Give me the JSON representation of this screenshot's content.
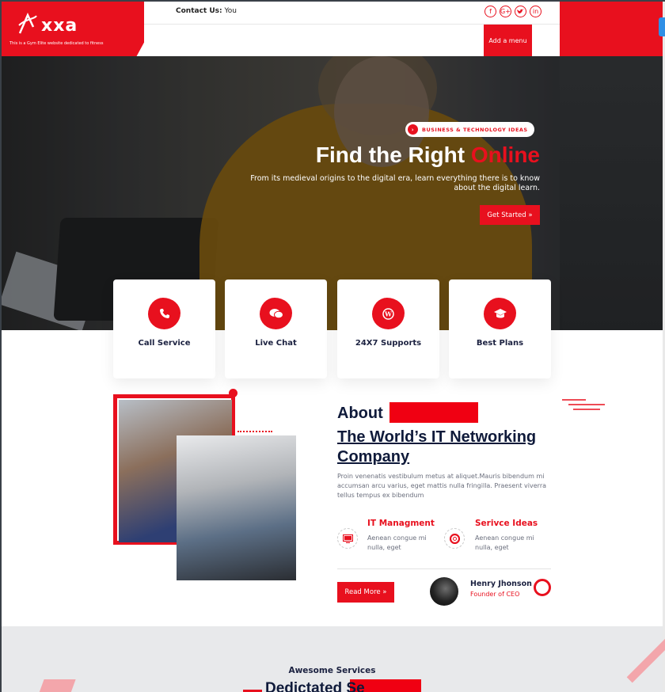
{
  "header": {
    "logo_text": "xxa",
    "logo_tagline": "This is a Gym Elite website dedicated to fitness",
    "contact_label": "Contact Us:",
    "contact_value": "You",
    "socials": [
      "f",
      "G+",
      "t",
      "in"
    ],
    "menu_button": "Add a menu"
  },
  "hero": {
    "pill_label": "BUSINESS & TECHNOLOGY IDEAS",
    "pill_icon": "chevron-right",
    "title_plain": "Find the Right",
    "title_accent": "Online",
    "description": "From its medieval origins to the digital era, learn everything there is to know about the digital learn.",
    "cta": "Get Started »"
  },
  "features": [
    {
      "label": "Call Service",
      "icon": "phone-icon"
    },
    {
      "label": "Live Chat",
      "icon": "chat-icon"
    },
    {
      "label": "24X7 Supports",
      "icon": "wordpress-icon"
    },
    {
      "label": "Best Plans",
      "icon": "graduation-cap-icon"
    }
  ],
  "about": {
    "heading": "About",
    "subheading": "The World’s IT Networking Company",
    "paragraph": "Proin venenatis vestibulum metus at aliquet.Mauris bibendum mi accumsan arcu varius, eget mattis nulla fringilla. Praesent viverra tellus tempus ex bibendum",
    "services": [
      {
        "title": "IT Managment",
        "desc": "Aenean congue mi nulla, eget",
        "icon": "monitor-icon"
      },
      {
        "title": "Serivce Ideas",
        "desc": "Aenean congue mi nulla, eget",
        "icon": "lifebuoy-icon"
      }
    ],
    "read_more": "Read More »",
    "person_name": "Henry Jhonson",
    "person_role": "Founder of CEO"
  },
  "services_band": {
    "subtitle": "Awesome Services",
    "title": "Dedictated Se"
  },
  "colors": {
    "accent": "#e8101e",
    "navy": "#0f1a3a",
    "band": "#e8e9eb"
  }
}
